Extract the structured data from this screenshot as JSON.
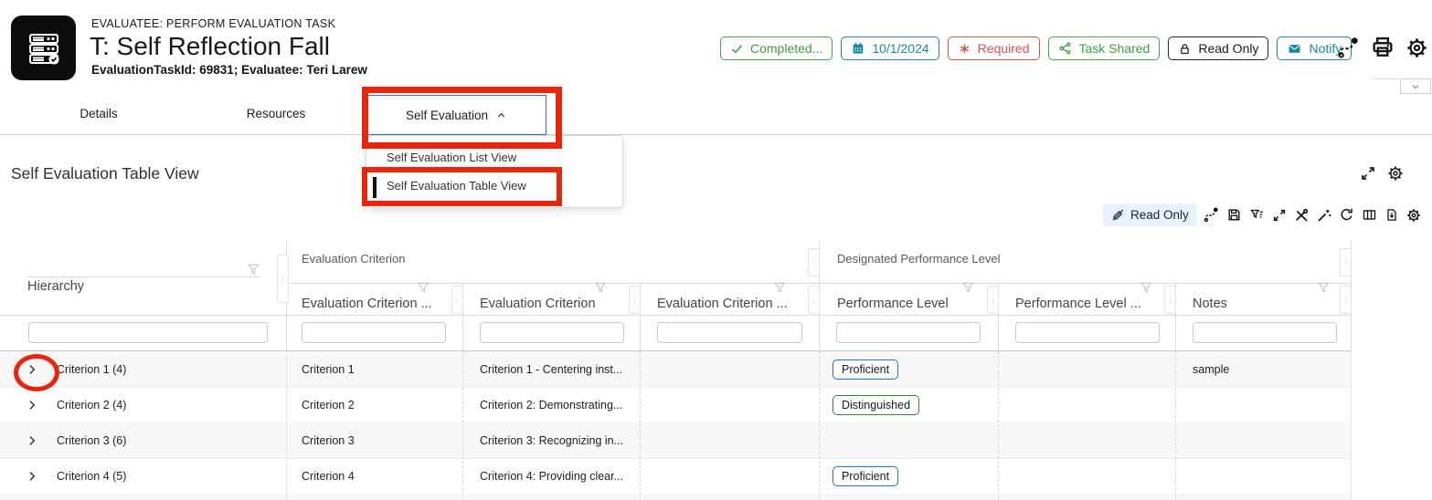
{
  "window": {
    "eyebrow": "EVALUATEE: PERFORM EVALUATION TASK",
    "title": "T: Self Reflection Fall",
    "subtitle": "EvaluationTaskId: 69831; Evaluatee: Teri Larew"
  },
  "status_badges": {
    "completed": "Completed...",
    "due_date": "10/1/2024",
    "required": "Required",
    "task_shared": "Task Shared",
    "read_only": "Read Only",
    "notify": "Notify"
  },
  "tabs": {
    "details": "Details",
    "resources": "Resources",
    "self_evaluation": "Self Evaluation"
  },
  "menu": {
    "list_view": "Self Evaluation List View",
    "table_view": "Self Evaluation Table View"
  },
  "page": {
    "title": "Self Evaluation Table View"
  },
  "toolbar": {
    "read_only": "Read Only"
  },
  "table": {
    "group_headers": {
      "evaluation_criterion": "Evaluation Criterion",
      "designated_performance_level": "Designated Performance Level"
    },
    "column_headers": {
      "hierarchy": "Hierarchy",
      "criterion_number": "Evaluation Criterion ...",
      "criterion": "Evaluation Criterion",
      "criterion_extra": "Evaluation Criterion ...",
      "performance_level": "Performance Level",
      "performance_level_extra": "Performance Level ...",
      "notes": "Notes"
    },
    "rows": [
      {
        "hierarchy": "Criterion 1 (4)",
        "criterion_number": "Criterion 1",
        "criterion": "Criterion 1 - Centering inst...",
        "performance_level": "Proficient",
        "notes": "sample"
      },
      {
        "hierarchy": "Criterion 2 (4)",
        "criterion_number": "Criterion 2",
        "criterion": "Criterion 2: Demonstrating...",
        "performance_level": "Distinguished",
        "notes": ""
      },
      {
        "hierarchy": "Criterion 3 (6)",
        "criterion_number": "Criterion 3",
        "criterion": "Criterion 3: Recognizing in...",
        "performance_level": "",
        "notes": ""
      },
      {
        "hierarchy": "Criterion 4 (5)",
        "criterion_number": "Criterion 4",
        "criterion": "Criterion 4: Providing clear...",
        "performance_level": "Proficient",
        "notes": ""
      }
    ]
  },
  "icons": [
    "check-icon",
    "calendar-icon",
    "asterisk-icon",
    "share-icon",
    "lock-icon",
    "envelope-icon",
    "map-route-icon",
    "printer-icon",
    "gear-icon",
    "chevron-down-icon",
    "caret-up-icon",
    "expand-icon",
    "pencil-slash-icon",
    "save-icon",
    "filter-list-icon",
    "tools-icon",
    "magic-wand-icon",
    "refresh-icon",
    "columns-icon",
    "file-download-icon",
    "filter-funnel-icon",
    "drag-handle-icon",
    "chevron-right-icon"
  ],
  "colors": {
    "badge_green": "#3d9a46",
    "badge_teal": "#1a8a9e",
    "badge_red": "#d9534f",
    "annotation_red": "#e8260c",
    "tab_focus_blue": "#2e6cd9",
    "proficient_border": "#1d6fe8",
    "distinguished_border": "#3c7d3f",
    "readonly_chip_bg": "#e9f1fd"
  }
}
